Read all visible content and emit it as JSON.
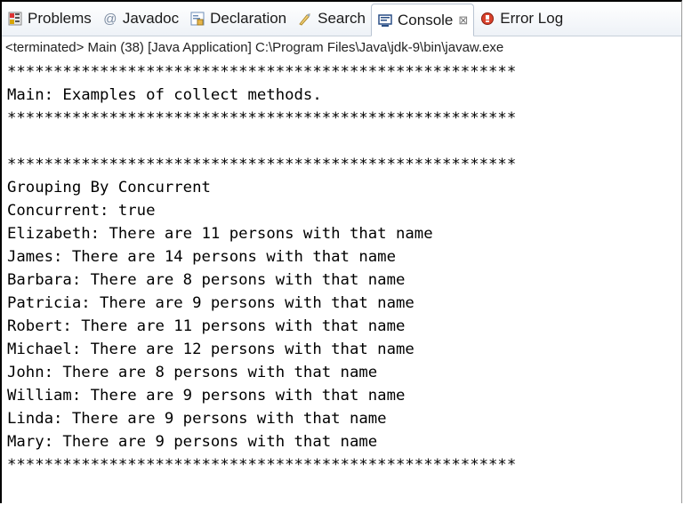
{
  "tabs": [
    {
      "label": "Problems",
      "icon": "problems-icon"
    },
    {
      "label": "Javadoc",
      "icon": "javadoc-icon"
    },
    {
      "label": "Declaration",
      "icon": "declaration-icon"
    },
    {
      "label": "Search",
      "icon": "search-icon"
    },
    {
      "label": "Console",
      "icon": "console-icon",
      "active": true,
      "close": "⊠"
    },
    {
      "label": "Error Log",
      "icon": "error-log-icon"
    }
  ],
  "status_text": "<terminated> Main (38) [Java Application] C:\\Program Files\\Java\\jdk-9\\bin\\javaw.exe",
  "console_lines": [
    "*******************************************************",
    "Main: Examples of collect methods.",
    "*******************************************************",
    "",
    "*******************************************************",
    "Grouping By Concurrent",
    "Concurrent: true",
    "Elizabeth: There are 11 persons with that name",
    "James: There are 14 persons with that name",
    "Barbara: There are 8 persons with that name",
    "Patricia: There are 9 persons with that name",
    "Robert: There are 11 persons with that name",
    "Michael: There are 12 persons with that name",
    "John: There are 8 persons with that name",
    "William: There are 9 persons with that name",
    "Linda: There are 9 persons with that name",
    "Mary: There are 9 persons with that name",
    "*******************************************************"
  ]
}
